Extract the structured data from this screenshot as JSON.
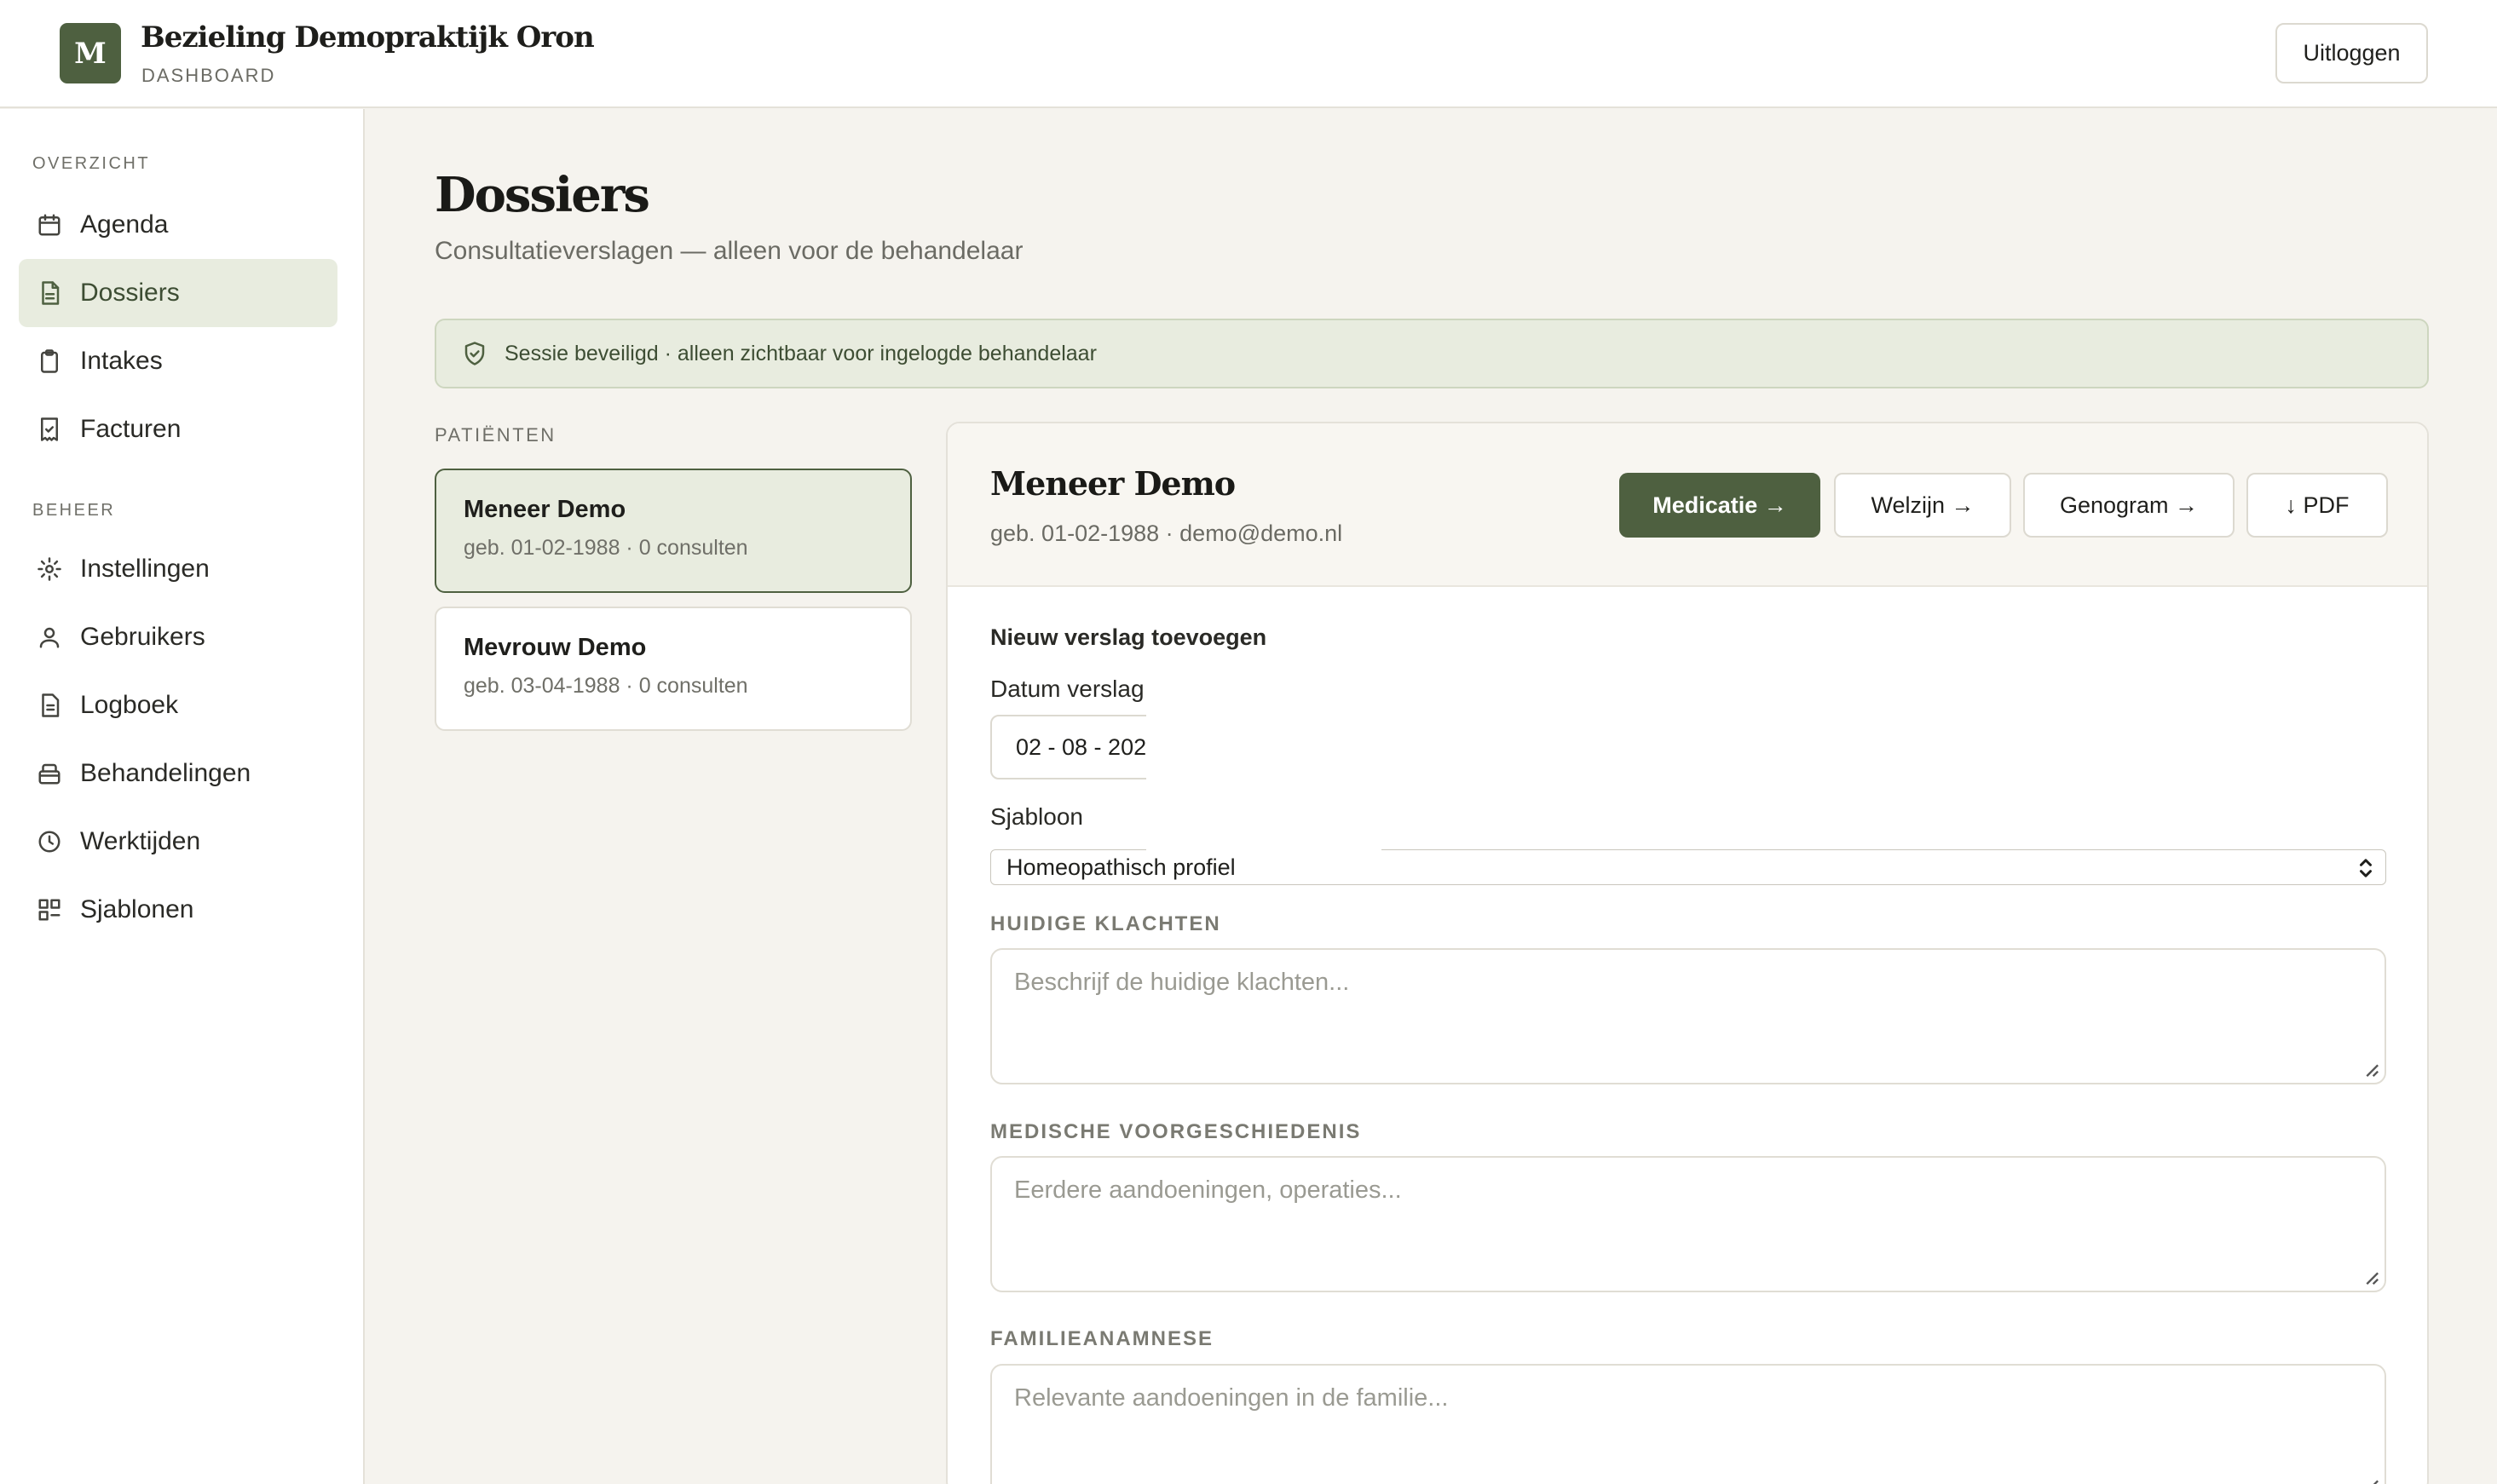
{
  "header": {
    "logo_letter": "M",
    "title": "Bezieling Demopraktijk Oron",
    "subtitle": "DASHBOARD",
    "logout_label": "Uitloggen"
  },
  "sidebar": {
    "section_overview": "OVERZICHT",
    "section_manage": "BEHEER",
    "items": [
      {
        "label": "Agenda",
        "icon": "calendar-icon"
      },
      {
        "label": "Dossiers",
        "icon": "document-icon",
        "active": true
      },
      {
        "label": "Intakes",
        "icon": "clipboard-icon"
      },
      {
        "label": "Facturen",
        "icon": "receipt-icon"
      },
      {
        "label": "Instellingen",
        "icon": "gear-icon"
      },
      {
        "label": "Gebruikers",
        "icon": "users-icon"
      },
      {
        "label": "Logboek",
        "icon": "logbook-icon"
      },
      {
        "label": "Behandelingen",
        "icon": "box-icon"
      },
      {
        "label": "Werktijden",
        "icon": "clock-icon"
      },
      {
        "label": "Sjablonen",
        "icon": "templates-icon"
      }
    ]
  },
  "main": {
    "title": "Dossiers",
    "subtitle": "Consultatieverslagen — alleen voor de behandelaar",
    "notice": "Sessie beveiligd · alleen zichtbaar voor ingelogde behandelaar",
    "patients_label": "PATIËNTEN",
    "patients": [
      {
        "name": "Meneer Demo",
        "meta": "geb. 01-02-1988 · 0 consulten",
        "selected": true
      },
      {
        "name": "Mevrouw Demo",
        "meta": "geb. 03-04-1988 · 0 consulten",
        "selected": false
      }
    ]
  },
  "detail": {
    "name": "Meneer Demo",
    "meta": "geb. 01-02-1988 · demo@demo.nl",
    "buttons": {
      "medication": "Medicatie →",
      "wellbeing": "Welzijn →",
      "genogram": "Genogram →",
      "pdf": "↓ PDF"
    },
    "form_title": "Nieuw verslag toevoegen",
    "date_label": "Datum verslag",
    "date_value": "02 - 08 - 202",
    "template_label": "Sjabloon",
    "template_value": "Homeopathisch profiel",
    "sections": [
      {
        "label": "HUIDIGE KLACHTEN",
        "placeholder": "Beschrijf de huidige klachten..."
      },
      {
        "label": "MEDISCHE VOORGESCHIEDENIS",
        "placeholder": "Eerdere aandoeningen, operaties..."
      },
      {
        "label": "FAMILIEANAMNESE",
        "placeholder": "Relevante aandoeningen in de familie..."
      }
    ]
  },
  "colors": {
    "accent": "#4e6040",
    "accent_soft": "#e8ecdf",
    "background": "#f5f3ee"
  }
}
